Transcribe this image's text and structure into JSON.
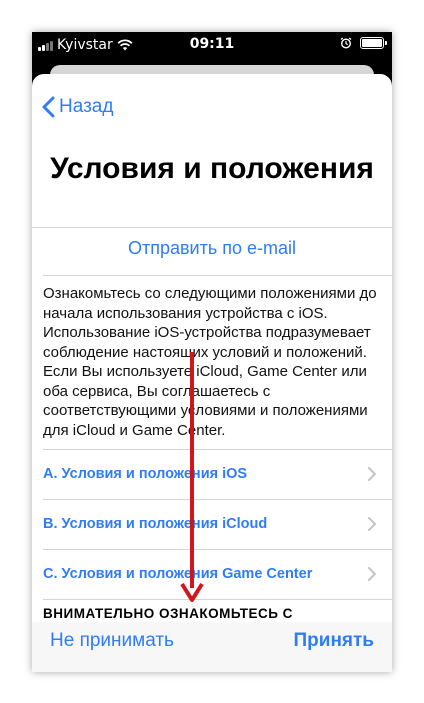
{
  "status_bar": {
    "carrier": "Kyivstar",
    "time": "09:11"
  },
  "nav": {
    "back_label": "Назад"
  },
  "page": {
    "title": "Условия и положения",
    "email_link": "Отправить по e-mail",
    "intro_text": "Ознакомьтесь со следующими положениями до начала использования устройства с iOS. Использование iOS-устройства подразумевает соблюдение настоящих условий и положений. Если Вы используете iCloud, Game Center или оба сервиса, Вы соглашаетесь с соответствующими условиями и положениями для iCloud и Game Center.",
    "sections": [
      {
        "label": "A. Условия и положения iOS"
      },
      {
        "label": "B. Условия и положения iCloud"
      },
      {
        "label": "C. Условия и положения Game Center"
      }
    ],
    "notice_heading": "ВНИМАТЕЛЬНО ОЗНАКОМЬТЕСЬ С"
  },
  "actions": {
    "decline_label": "Не принимать",
    "accept_label": "Принять"
  },
  "colors": {
    "accent": "#2f7cf6",
    "annotation_arrow": "#d0161b"
  },
  "icons": {
    "back": "chevron-left-icon",
    "row": "chevron-right-icon",
    "wifi": "wifi-icon",
    "alarm": "alarm-icon",
    "battery": "battery-icon"
  }
}
